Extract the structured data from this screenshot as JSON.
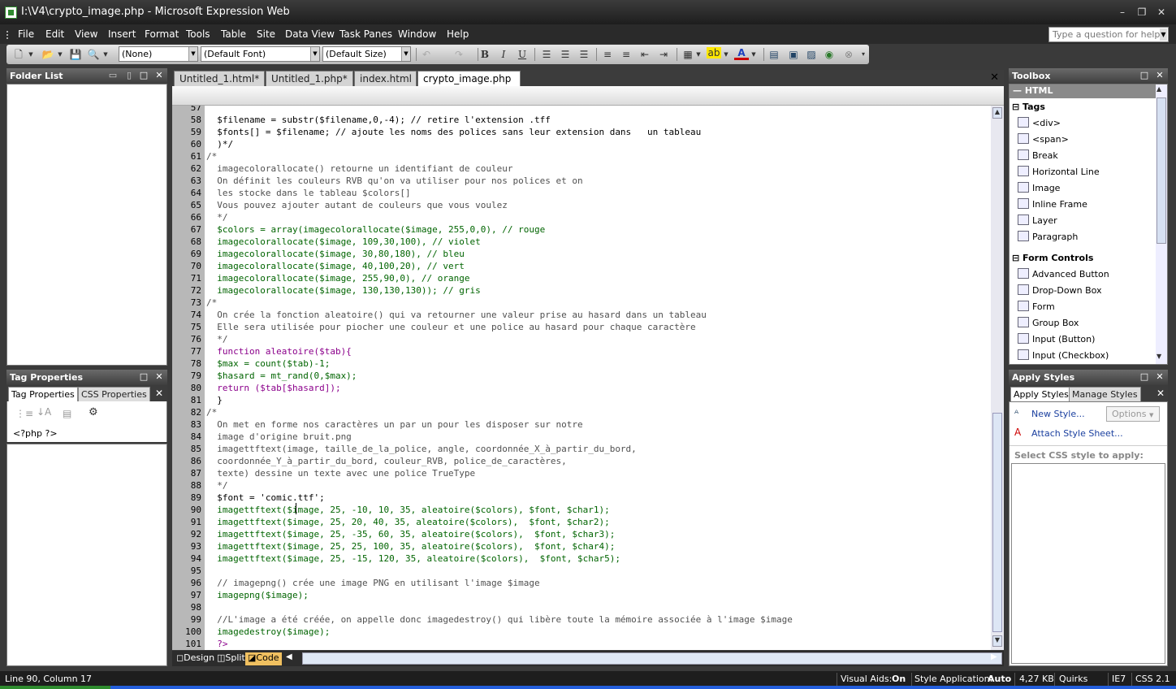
{
  "window": {
    "title": "I:\\V4\\crypto_image.php - Microsoft Expression Web"
  },
  "menu": {
    "items": [
      "File",
      "Edit",
      "View",
      "Insert",
      "Format",
      "Tools",
      "Table",
      "Site",
      "Data View",
      "Task Panes",
      "Window",
      "Help"
    ],
    "help_placeholder": "Type a question for help"
  },
  "toolbar": {
    "style_combo": "(None)",
    "font_combo": "(Default Font)",
    "size_combo": "(Default Size)"
  },
  "folder_list": {
    "title": "Folder List"
  },
  "tag_properties": {
    "title": "Tag Properties",
    "tabs": [
      "Tag Properties",
      "CSS Properties"
    ],
    "tag": "<?php ?>"
  },
  "doc_tabs": [
    "Untitled_1.html*",
    "Untitled_1.php*",
    "index.html",
    "crypto_image.php"
  ],
  "code": {
    "first_line_partial": "57",
    "lines": [
      {
        "n": "58",
        "t": "  $filename = substr($filename,0,-4); // retire l'extension .tff"
      },
      {
        "n": "59",
        "t": "  $fonts[] = $filename; // ajoute les noms des polices sans leur extension dans   un tableau"
      },
      {
        "n": "60",
        "t": "  )*/"
      },
      {
        "n": "61",
        "t": "/*"
      },
      {
        "n": "62",
        "t": "  imagecolorallocate() retourne un identifiant de couleur"
      },
      {
        "n": "63",
        "t": "  On définit les couleurs RVB qu'on va utiliser pour nos polices et on"
      },
      {
        "n": "64",
        "t": "  les stocke dans le tableau $colors[]"
      },
      {
        "n": "65",
        "t": "  Vous pouvez ajouter autant de couleurs que vous voulez"
      },
      {
        "n": "66",
        "t": "  */"
      },
      {
        "n": "67",
        "t": "  $colors = array(imagecolorallocate($image, 255,0,0), // rouge"
      },
      {
        "n": "68",
        "t": "  imagecolorallocate($image, 109,30,100), // violet"
      },
      {
        "n": "69",
        "t": "  imagecolorallocate($image, 30,80,180), // bleu"
      },
      {
        "n": "70",
        "t": "  imagecolorallocate($image, 40,100,20), // vert"
      },
      {
        "n": "71",
        "t": "  imagecolorallocate($image, 255,90,0), // orange"
      },
      {
        "n": "72",
        "t": "  imagecolorallocate($image, 130,130,130)); // gris"
      },
      {
        "n": "73",
        "t": "/*"
      },
      {
        "n": "74",
        "t": "  On crée la fonction aleatoire() qui va retourner une valeur prise au hasard dans un tableau"
      },
      {
        "n": "75",
        "t": "  Elle sera utilisée pour piocher une couleur et une police au hasard pour chaque caractère"
      },
      {
        "n": "76",
        "t": "  */"
      },
      {
        "n": "77",
        "t": "  function aleatoire($tab){"
      },
      {
        "n": "78",
        "t": "  $max = count($tab)-1;"
      },
      {
        "n": "79",
        "t": "  $hasard = mt_rand(0,$max);"
      },
      {
        "n": "80",
        "t": "  return ($tab[$hasard]);"
      },
      {
        "n": "81",
        "t": "  }"
      },
      {
        "n": "82",
        "t": "/*"
      },
      {
        "n": "83",
        "t": "  On met en forme nos caractères un par un pour les disposer sur notre"
      },
      {
        "n": "84",
        "t": "  image d'origine bruit.png"
      },
      {
        "n": "85",
        "t": "  imagettftext(image, taille_de_la_police, angle, coordonnée_X_à_partir_du_bord,"
      },
      {
        "n": "86",
        "t": "  coordonnée_Y_à_partir_du_bord, couleur_RVB, police_de_caractères,"
      },
      {
        "n": "87",
        "t": "  texte) dessine un texte avec une police TrueType"
      },
      {
        "n": "88",
        "t": "  */"
      },
      {
        "n": "89",
        "t": "  $font = 'comic.ttf';"
      },
      {
        "n": "90",
        "t": "  imagettftext($image, 25, -10, 10, 35, aleatoire($colors), $font, $char1);"
      },
      {
        "n": "91",
        "t": "  imagettftext($image, 25, 20, 40, 35, aleatoire($colors),  $font, $char2);"
      },
      {
        "n": "92",
        "t": "  imagettftext($image, 25, -35, 60, 35, aleatoire($colors),  $font, $char3);"
      },
      {
        "n": "93",
        "t": "  imagettftext($image, 25, 25, 100, 35, aleatoire($colors),  $font, $char4);"
      },
      {
        "n": "94",
        "t": "  imagettftext($image, 25, -15, 120, 35, aleatoire($colors),  $font, $char5);"
      },
      {
        "n": "95",
        "t": ""
      },
      {
        "n": "96",
        "t": "  // imagepng() crée une image PNG en utilisant l'image $image"
      },
      {
        "n": "97",
        "t": "  imagepng($image);"
      },
      {
        "n": "98",
        "t": ""
      },
      {
        "n": "99",
        "t": "  //L'image a été créée, on appelle donc imagedestroy() qui libère toute la mémoire associée à l'image $image"
      },
      {
        "n": "100",
        "t": "  imagedestroy($image);"
      },
      {
        "n": "101",
        "t": "  ?>"
      }
    ]
  },
  "view_bar": {
    "design": "Design",
    "split": "Split",
    "code": "Code"
  },
  "toolbox": {
    "title": "Toolbox",
    "section": "HTML",
    "tags_group": "Tags",
    "tags": [
      "<div>",
      "<span>",
      "Break",
      "Horizontal Line",
      "Image",
      "Inline Frame",
      "Layer",
      "Paragraph"
    ],
    "form_group": "Form Controls",
    "form": [
      "Advanced Button",
      "Drop-Down Box",
      "Form",
      "Group Box",
      "Input (Button)",
      "Input (Checkbox)"
    ]
  },
  "apply_styles": {
    "title": "Apply Styles",
    "tabs": [
      "Apply Styles",
      "Manage Styles"
    ],
    "new_style": "New Style...",
    "options": "Options",
    "attach": "Attach Style Sheet...",
    "select_label": "Select CSS style to apply:"
  },
  "status": {
    "position": "Line 90, Column 17",
    "visual_aids_label": "Visual Aids:",
    "visual_aids_value": "On",
    "style_app_label": "Style Application:",
    "style_app_value": "Auto",
    "size": "4,27 KB",
    "mode": "Quirks",
    "browser": "IE7",
    "css": "CSS 2.1"
  }
}
